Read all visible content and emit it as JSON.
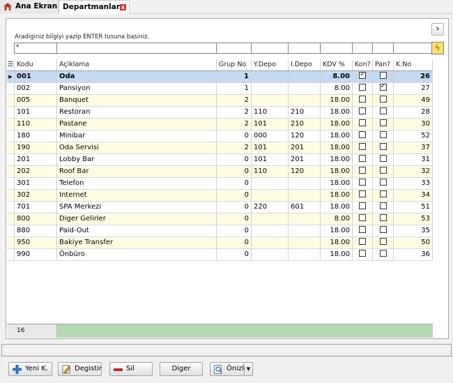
{
  "tabs": [
    {
      "label": "Ana Ekran"
    },
    {
      "label": "Departmanlar",
      "close": "x"
    }
  ],
  "search": {
    "hint": "Aradiginiz bilgiyi yazip ENTER tusuna basiniz.",
    "filter_first": "*"
  },
  "grid": {
    "columns": [
      "Kodu",
      "Açiklama",
      "Grup No",
      "Y.Depo",
      "I.Depo",
      "KDV %",
      "Kon?",
      "Pan?",
      "K.No"
    ],
    "rows": [
      {
        "kodu": "001",
        "aciklama": "Oda",
        "grup": "1",
        "ydepo": "",
        "idepo": "",
        "kdv": "8.00",
        "kon": true,
        "pan": false,
        "kno": "26"
      },
      {
        "kodu": "002",
        "aciklama": "Pansiyon",
        "grup": "1",
        "ydepo": "",
        "idepo": "",
        "kdv": "8.00",
        "kon": false,
        "pan": true,
        "kno": "27"
      },
      {
        "kodu": "005",
        "aciklama": "Banquet",
        "grup": "2",
        "ydepo": "",
        "idepo": "",
        "kdv": "18.00",
        "kon": false,
        "pan": false,
        "kno": "49"
      },
      {
        "kodu": "101",
        "aciklama": "Restoran",
        "grup": "2",
        "ydepo": "110",
        "idepo": "210",
        "kdv": "18.00",
        "kon": false,
        "pan": false,
        "kno": "28"
      },
      {
        "kodu": "110",
        "aciklama": "Pastane",
        "grup": "2",
        "ydepo": "101",
        "idepo": "210",
        "kdv": "18.00",
        "kon": false,
        "pan": false,
        "kno": "30"
      },
      {
        "kodu": "180",
        "aciklama": "Minibar",
        "grup": "0",
        "ydepo": "000",
        "idepo": "120",
        "kdv": "18.00",
        "kon": false,
        "pan": false,
        "kno": "52"
      },
      {
        "kodu": "190",
        "aciklama": "Oda Servisi",
        "grup": "2",
        "ydepo": "101",
        "idepo": "201",
        "kdv": "18.00",
        "kon": false,
        "pan": false,
        "kno": "37"
      },
      {
        "kodu": "201",
        "aciklama": "Lobby Bar",
        "grup": "0",
        "ydepo": "101",
        "idepo": "201",
        "kdv": "18.00",
        "kon": false,
        "pan": false,
        "kno": "31"
      },
      {
        "kodu": "202",
        "aciklama": "Roof Bar",
        "grup": "0",
        "ydepo": "110",
        "idepo": "120",
        "kdv": "18.00",
        "kon": false,
        "pan": false,
        "kno": "32"
      },
      {
        "kodu": "301",
        "aciklama": "Telefon",
        "grup": "0",
        "ydepo": "",
        "idepo": "",
        "kdv": "18.00",
        "kon": false,
        "pan": false,
        "kno": "33"
      },
      {
        "kodu": "302",
        "aciklama": "Internet",
        "grup": "0",
        "ydepo": "",
        "idepo": "",
        "kdv": "18.00",
        "kon": false,
        "pan": false,
        "kno": "34"
      },
      {
        "kodu": "701",
        "aciklama": "SPA Merkezi",
        "grup": "0",
        "ydepo": "220",
        "idepo": "601",
        "kdv": "18.00",
        "kon": false,
        "pan": false,
        "kno": "51"
      },
      {
        "kodu": "800",
        "aciklama": "Diger Gelirler",
        "grup": "0",
        "ydepo": "",
        "idepo": "",
        "kdv": "8.00",
        "kon": false,
        "pan": false,
        "kno": "53"
      },
      {
        "kodu": "880",
        "aciklama": "Paid-Out",
        "grup": "0",
        "ydepo": "",
        "idepo": "",
        "kdv": "18.00",
        "kon": false,
        "pan": false,
        "kno": "35"
      },
      {
        "kodu": "950",
        "aciklama": "Bakiye Transfer",
        "grup": "0",
        "ydepo": "",
        "idepo": "",
        "kdv": "18.00",
        "kon": false,
        "pan": false,
        "kno": "50"
      },
      {
        "kodu": "990",
        "aciklama": "Önbüro",
        "grup": "0",
        "ydepo": "",
        "idepo": "",
        "kdv": "18.00",
        "kon": false,
        "pan": false,
        "kno": "36"
      }
    ],
    "row_count": "16"
  },
  "toolbar": {
    "new_label": "Yeni K.",
    "edit_label": "Degistir",
    "delete_label": "Sil",
    "other_label": "Diger",
    "preview_label": "Önizle"
  },
  "colors": {
    "row_alt": "#fefde4",
    "row_selected": "#c5daf2",
    "footer_green": "#b3d9b0"
  }
}
